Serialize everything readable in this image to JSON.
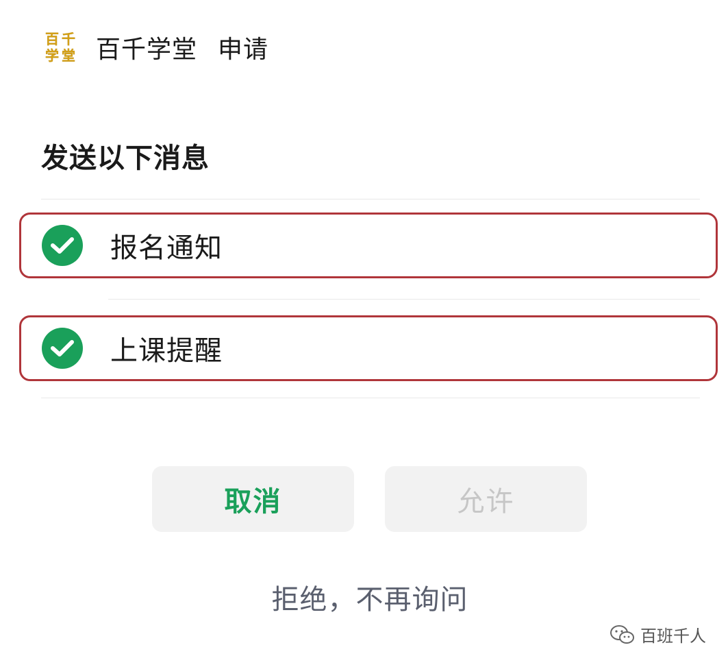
{
  "header": {
    "logo_chars": [
      "百",
      "千",
      "学",
      "堂"
    ],
    "app_name": "百千学堂",
    "action": "申请"
  },
  "section": {
    "title": "发送以下消息"
  },
  "options": [
    {
      "label": "报名通知",
      "checked": true
    },
    {
      "label": "上课提醒",
      "checked": true
    }
  ],
  "buttons": {
    "cancel": "取消",
    "allow": "允许"
  },
  "reject_link": "拒绝，不再询问",
  "watermark": {
    "icon": "wechat-icon",
    "text": "百班千人"
  },
  "colors": {
    "accent_green": "#1aa05a",
    "highlight_border": "#b0353a",
    "disabled_text": "#c6c6c6",
    "logo_gold": "#d4a017"
  }
}
